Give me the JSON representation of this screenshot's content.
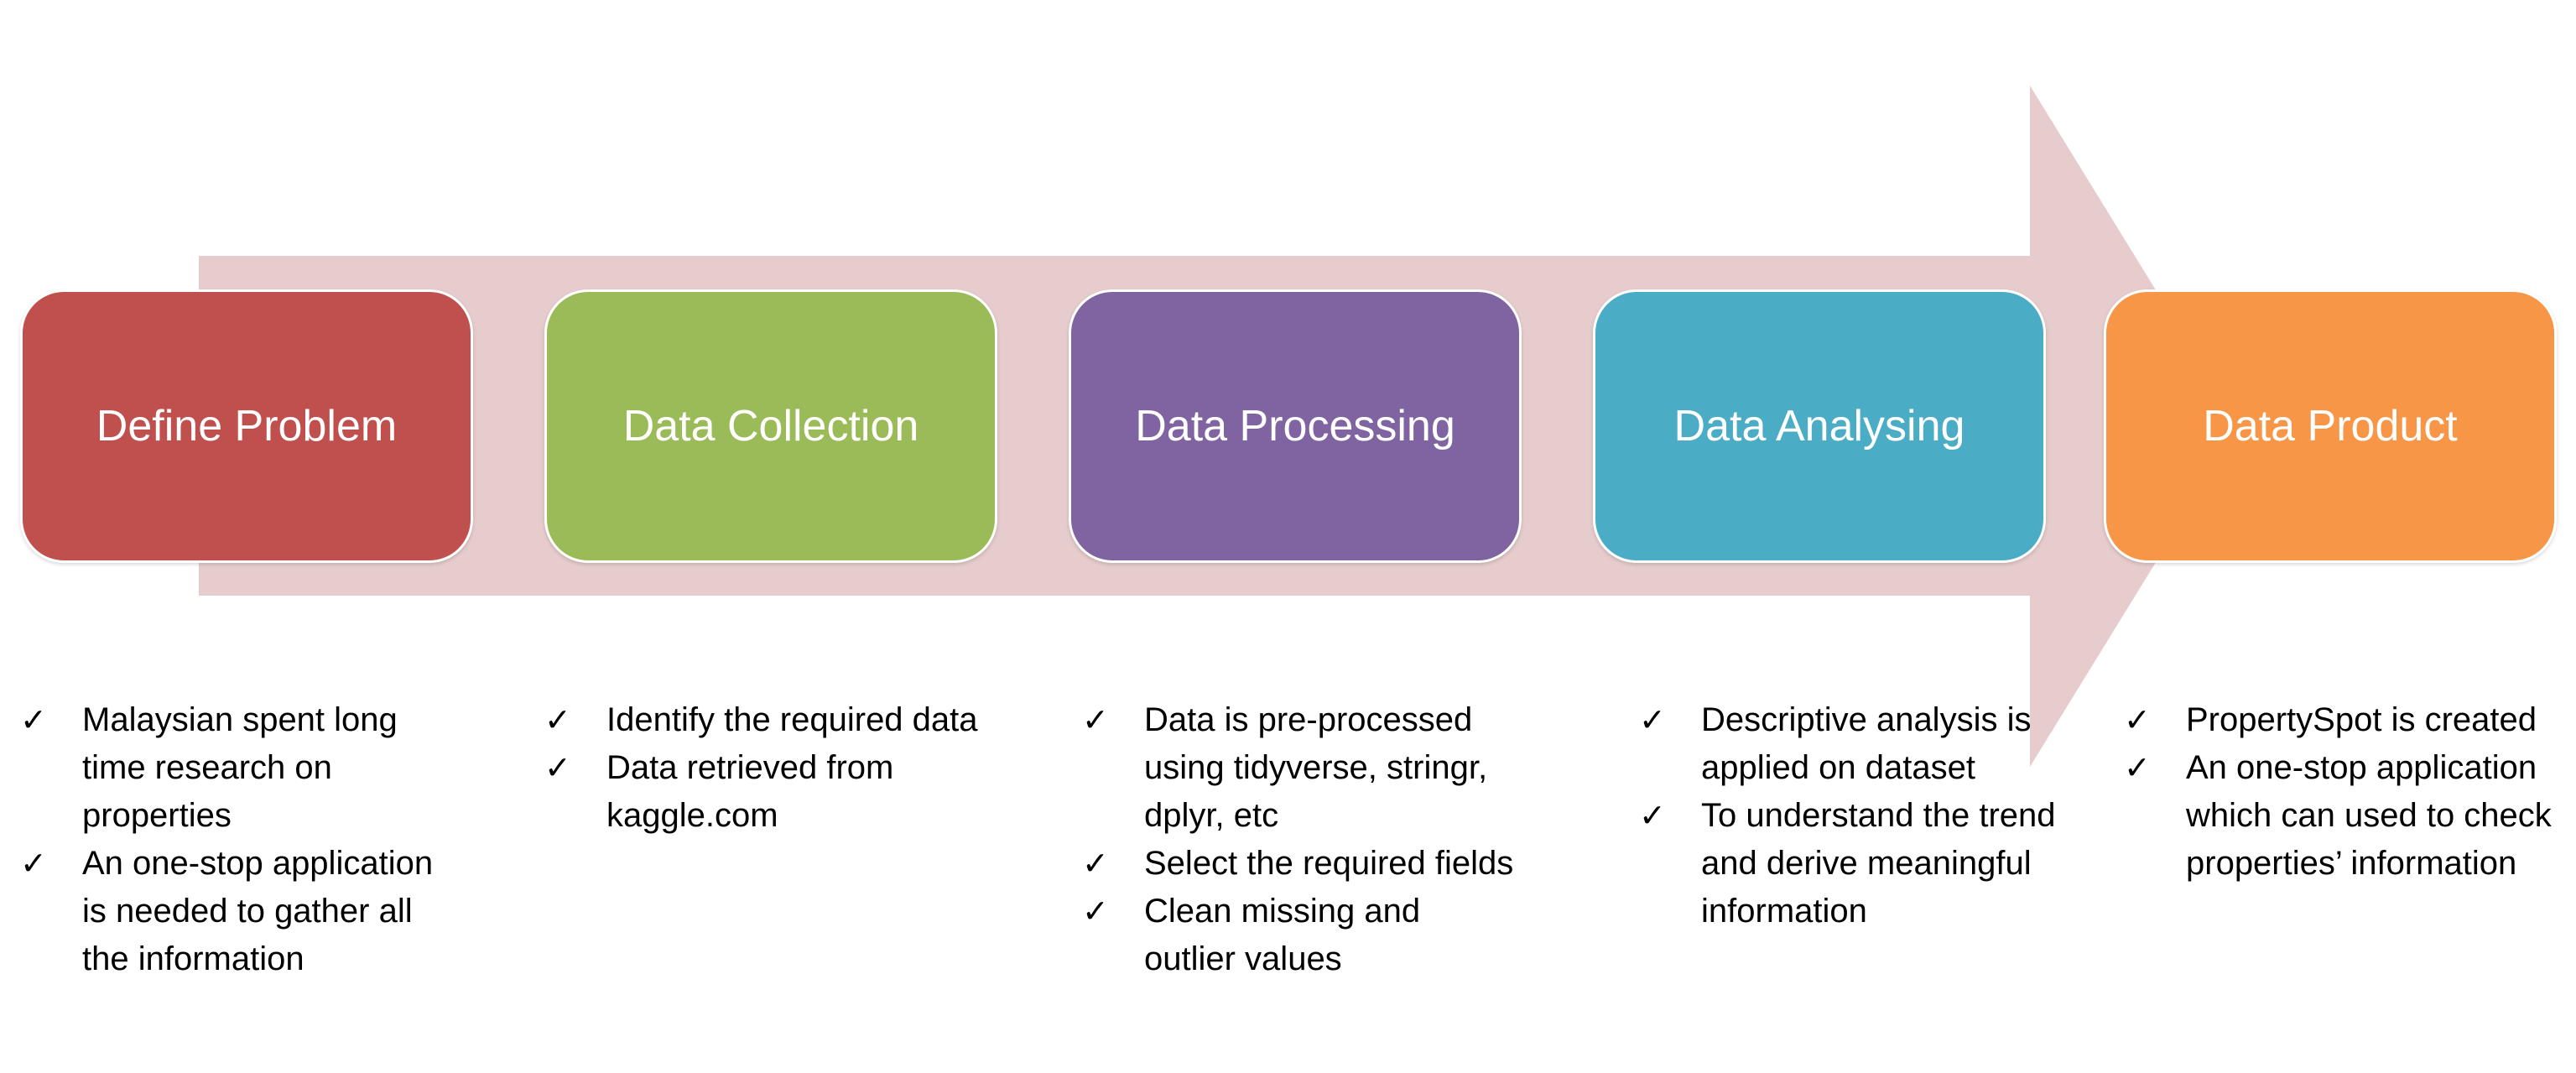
{
  "colors": {
    "arrow": "#E6CCCC",
    "stage_1": "#C0504D",
    "stage_2": "#9BBB59",
    "stage_3": "#8064A2",
    "stage_4": "#4BACC6",
    "stage_5": "#F79646"
  },
  "stages": [
    {
      "label": "Define Problem"
    },
    {
      "label": "Data Collection"
    },
    {
      "label": "Data Processing"
    },
    {
      "label": "Data Analysing"
    },
    {
      "label": "Data Product"
    }
  ],
  "bullets": [
    [
      "Malaysian spent long time research on properties",
      "An one-stop application is needed to gather all the information"
    ],
    [
      "Identify the required data",
      "Data retrieved from kaggle.com"
    ],
    [
      "Data is pre-processed using tidyverse, stringr, dplyr, etc",
      "Select the required fields",
      "Clean missing and outlier values"
    ],
    [
      "Descriptive analysis is applied on dataset",
      "To understand the trend and derive meaningful information"
    ],
    [
      "PropertySpot is created",
      "An one-stop application which can used to check properties’ information"
    ]
  ],
  "check_glyph": "✓"
}
